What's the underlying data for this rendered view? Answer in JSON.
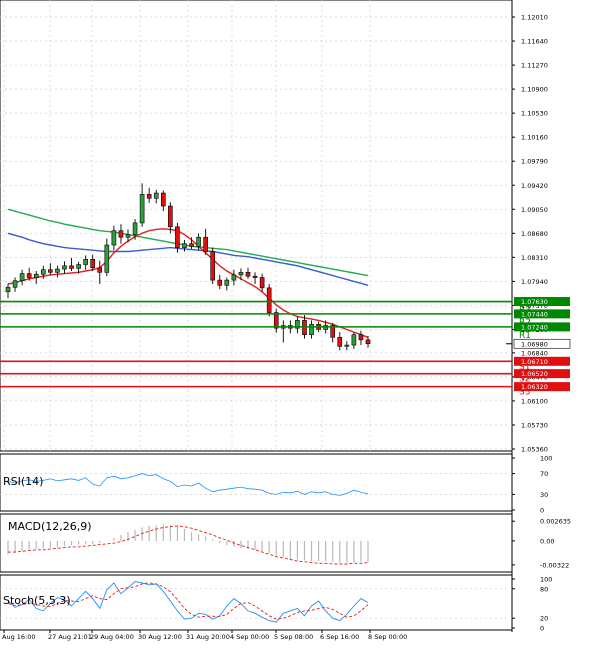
{
  "chart_data": [
    {
      "type": "candlestick",
      "panel": "price",
      "ylim": [
        1.0536,
        1.1201
      ],
      "y_ticks": [
        "1.12010",
        "1.11640",
        "1.11270",
        "1.10900",
        "1.10530",
        "1.10160",
        "1.09790",
        "1.09420",
        "1.09050",
        "1.08680",
        "1.08310",
        "1.07940",
        "1.07570",
        "1.07200",
        "1.06840",
        "1.06470",
        "1.06100",
        "1.05730",
        "1.05360"
      ],
      "x_ticks": [
        "Aug 16:00",
        "27 Aug 21:01",
        "29 Aug 04:00",
        "30 Aug 12:00",
        "31 Aug 20:00",
        "4 Sep 00:00",
        "5 Sep 08:00",
        "6 Sep 16:00",
        "8 Sep 00:00"
      ],
      "last_price": "1.06980",
      "candles": [
        [
          1.0778,
          1.079,
          1.0768,
          1.0785
        ],
        [
          1.0785,
          1.08,
          1.0778,
          1.0795
        ],
        [
          1.0795,
          1.0812,
          1.0788,
          1.0806
        ],
        [
          1.0806,
          1.0815,
          1.0795,
          1.08
        ],
        [
          1.08,
          1.081,
          1.079,
          1.0805
        ],
        [
          1.0805,
          1.0818,
          1.0798,
          1.0812
        ],
        [
          1.0812,
          1.0822,
          1.0804,
          1.0808
        ],
        [
          1.0808,
          1.0818,
          1.08,
          1.0813
        ],
        [
          1.0813,
          1.0825,
          1.0806,
          1.0818
        ],
        [
          1.0818,
          1.083,
          1.081,
          1.0814
        ],
        [
          1.0814,
          1.0824,
          1.0806,
          1.082
        ],
        [
          1.082,
          1.0834,
          1.0812,
          1.0828
        ],
        [
          1.0828,
          1.0835,
          1.081,
          1.0815
        ],
        [
          1.0815,
          1.0826,
          1.079,
          1.0808
        ],
        [
          1.0808,
          1.086,
          1.0802,
          1.085
        ],
        [
          1.085,
          1.088,
          1.0842,
          1.0872
        ],
        [
          1.0872,
          1.0882,
          1.0852,
          1.0862
        ],
        [
          1.0862,
          1.0874,
          1.0854,
          1.0866
        ],
        [
          1.0866,
          1.089,
          1.0858,
          1.0884
        ],
        [
          1.0884,
          1.0945,
          1.0878,
          1.0928
        ],
        [
          1.0928,
          1.0938,
          1.0915,
          1.0922
        ],
        [
          1.0922,
          1.0935,
          1.0914,
          1.093
        ],
        [
          1.093,
          1.0934,
          1.0902,
          1.091
        ],
        [
          1.091,
          1.0916,
          1.0868,
          1.0878
        ],
        [
          1.0878,
          1.0884,
          1.0838,
          1.0846
        ],
        [
          1.0846,
          1.0858,
          1.084,
          1.0852
        ],
        [
          1.0852,
          1.0862,
          1.0844,
          1.0848
        ],
        [
          1.0848,
          1.0868,
          1.0842,
          1.0862
        ],
        [
          1.0862,
          1.0875,
          1.0835,
          1.084
        ],
        [
          1.084,
          1.0846,
          1.079,
          1.0796
        ],
        [
          1.0796,
          1.0804,
          1.0782,
          1.0788
        ],
        [
          1.0788,
          1.08,
          1.078,
          1.0796
        ],
        [
          1.0796,
          1.0812,
          1.0788,
          1.0804
        ],
        [
          1.0804,
          1.0814,
          1.0796,
          1.0808
        ],
        [
          1.0808,
          1.0815,
          1.0798,
          1.0802
        ],
        [
          1.0802,
          1.0808,
          1.079,
          1.08
        ],
        [
          1.08,
          1.0806,
          1.0778,
          1.0784
        ],
        [
          1.0784,
          1.079,
          1.074,
          1.0746
        ],
        [
          1.0746,
          1.0752,
          1.0715,
          1.0722
        ],
        [
          1.0722,
          1.0734,
          1.07,
          1.0726
        ],
        [
          1.0726,
          1.0734,
          1.0714,
          1.0722
        ],
        [
          1.0722,
          1.074,
          1.0714,
          1.0734
        ],
        [
          1.0734,
          1.0742,
          1.0706,
          1.0712
        ],
        [
          1.0712,
          1.0734,
          1.0706,
          1.0728
        ],
        [
          1.0728,
          1.0732,
          1.0716,
          1.072
        ],
        [
          1.072,
          1.0734,
          1.0714,
          1.0726
        ],
        [
          1.0726,
          1.073,
          1.07,
          1.0708
        ],
        [
          1.0708,
          1.0716,
          1.0688,
          1.0694
        ],
        [
          1.0694,
          1.0702,
          1.0688,
          1.0696
        ],
        [
          1.0696,
          1.0716,
          1.069,
          1.0712
        ],
        [
          1.0712,
          1.0718,
          1.0696,
          1.0704
        ],
        [
          1.0704,
          1.071,
          1.0692,
          1.0698
        ]
      ],
      "series": [
        {
          "color": "#22aa55",
          "values": [
            1.0905,
            1.0902,
            1.0899,
            1.0896,
            1.0893,
            1.089,
            1.0887,
            1.0885,
            1.0882,
            1.088,
            1.0878,
            1.0876,
            1.0874,
            1.0872,
            1.0871,
            1.087,
            1.0868,
            1.0866,
            1.0864,
            1.0862,
            1.086,
            1.0858,
            1.0856,
            1.0854,
            1.0852,
            1.085,
            1.0848,
            1.0847,
            1.0846,
            1.0845,
            1.0844,
            1.0843,
            1.0841,
            1.0839,
            1.0837,
            1.0835,
            1.0833,
            1.0831,
            1.0829,
            1.0827,
            1.0825,
            1.0823,
            1.0821,
            1.0819,
            1.0817,
            1.0815,
            1.0813,
            1.0811,
            1.0809,
            1.0807,
            1.0805,
            1.0803
          ]
        },
        {
          "color": "#3a5bd0",
          "values": [
            1.0868,
            1.0865,
            1.0862,
            1.0858,
            1.0855,
            1.0852,
            1.085,
            1.0848,
            1.0846,
            1.0845,
            1.0844,
            1.0843,
            1.0842,
            1.0841,
            1.084,
            1.084,
            1.084,
            1.084,
            1.0841,
            1.0842,
            1.0843,
            1.0844,
            1.0845,
            1.0846,
            1.0845,
            1.0844,
            1.0843,
            1.0842,
            1.0841,
            1.084,
            1.0838,
            1.0836,
            1.0834,
            1.0833,
            1.0832,
            1.083,
            1.0828,
            1.0826,
            1.0824,
            1.0822,
            1.082,
            1.0818,
            1.0815,
            1.0812,
            1.0809,
            1.0806,
            1.0803,
            1.08,
            1.0797,
            1.0794,
            1.0791,
            1.0788
          ]
        },
        {
          "color": "#e02020",
          "values": [
            1.079,
            1.0792,
            1.0795,
            1.0798,
            1.08,
            1.0802,
            1.0804,
            1.0805,
            1.0806,
            1.0807,
            1.0808,
            1.081,
            1.0812,
            1.0815,
            1.0825,
            1.0838,
            1.0848,
            1.0856,
            1.0863,
            1.0868,
            1.0872,
            1.0874,
            1.0875,
            1.0874,
            1.0872,
            1.0866,
            1.0858,
            1.0848,
            1.0838,
            1.0828,
            1.0818,
            1.081,
            1.0804,
            1.0798,
            1.0792,
            1.0786,
            1.0778,
            1.0768,
            1.0758,
            1.075,
            1.0744,
            1.074,
            1.0738,
            1.0736,
            1.0734,
            1.0731,
            1.0728,
            1.0724,
            1.072,
            1.0716,
            1.0712,
            1.0708
          ]
        }
      ],
      "levels": [
        {
          "label": "R3",
          "value": 1.0763,
          "value_text": "1.07630",
          "color": "#008800"
        },
        {
          "label": "R2",
          "value": 1.0744,
          "value_text": "1.07440",
          "color": "#008800"
        },
        {
          "label": "R1",
          "value": 1.0724,
          "value_text": "1.07240",
          "color": "#008800"
        },
        {
          "label": "S1",
          "value": 1.0671,
          "value_text": "1.06710",
          "color": "#e01010"
        },
        {
          "label": "S2",
          "value": 1.0652,
          "value_text": "1.06520",
          "color": "#e01010"
        },
        {
          "label": "S3",
          "value": 1.0632,
          "value_text": "1.06320",
          "color": "#e01010"
        }
      ]
    },
    {
      "type": "line",
      "panel": "rsi",
      "title": "RSI(14)",
      "ylim": [
        0,
        100
      ],
      "y_ticks": [
        "100",
        "70",
        "30",
        "0"
      ],
      "series": [
        {
          "color": "#1e90ff",
          "values": [
            55,
            52,
            56,
            58,
            55,
            57,
            60,
            56,
            58,
            60,
            57,
            62,
            50,
            46,
            62,
            65,
            60,
            62,
            66,
            70,
            66,
            68,
            60,
            55,
            45,
            48,
            46,
            52,
            42,
            35,
            38,
            40,
            42,
            44,
            41,
            40,
            38,
            32,
            30,
            34,
            33,
            36,
            30,
            35,
            33,
            35,
            30,
            28,
            32,
            38,
            34,
            31
          ]
        }
      ]
    },
    {
      "type": "line",
      "panel": "macd",
      "title": "MACD(12,26,9)",
      "ylim": [
        -0.0035,
        0.0028
      ],
      "y_ticks": [
        "0.002635",
        "0.00",
        "-0.00322"
      ],
      "histogram": [
        -0.0018,
        -0.0016,
        -0.0014,
        -0.0012,
        -0.0011,
        -0.001,
        -0.0009,
        -0.0008,
        -0.0007,
        -0.0006,
        -0.0005,
        -0.0004,
        -0.0004,
        -0.0003,
        0.0,
        0.0004,
        0.0008,
        0.0012,
        0.0015,
        0.0018,
        0.002,
        0.0021,
        0.0022,
        0.0021,
        0.0019,
        0.0016,
        0.0012,
        0.0009,
        0.0006,
        0.0002,
        -0.0003,
        -0.0006,
        -0.0008,
        -0.001,
        -0.0011,
        -0.0012,
        -0.0014,
        -0.0017,
        -0.002,
        -0.0022,
        -0.0024,
        -0.0025,
        -0.0026,
        -0.0027,
        -0.0027,
        -0.0027,
        -0.0028,
        -0.0029,
        -0.0029,
        -0.0029,
        -0.0028,
        -0.0028
      ],
      "signal": [
        -0.0015,
        -0.0015,
        -0.0014,
        -0.0013,
        -0.0012,
        -0.0012,
        -0.0011,
        -0.001,
        -0.0009,
        -0.0008,
        -0.0008,
        -0.0007,
        -0.0006,
        -0.0005,
        -0.0004,
        -0.0003,
        -0.0001,
        0.0002,
        0.0006,
        0.001,
        0.0013,
        0.0016,
        0.0018,
        0.0019,
        0.002,
        0.0019,
        0.0017,
        0.0014,
        0.0011,
        0.0008,
        0.0004,
        0.0001,
        -0.0003,
        -0.0006,
        -0.0009,
        -0.0012,
        -0.0015,
        -0.0018,
        -0.0021,
        -0.0023,
        -0.0025,
        -0.0027,
        -0.0028,
        -0.0029,
        -0.003,
        -0.003,
        -0.0031,
        -0.0031,
        -0.0031,
        -0.003,
        -0.003,
        -0.0029
      ]
    },
    {
      "type": "line",
      "panel": "stoch",
      "title": "Stoch(5,5,3)",
      "ylim": [
        0,
        100
      ],
      "y_ticks": [
        "100",
        "80",
        "20",
        "0"
      ],
      "series": [
        {
          "color": "#1e90ff",
          "values": [
            55,
            42,
            48,
            58,
            40,
            35,
            50,
            62,
            58,
            45,
            60,
            75,
            60,
            40,
            78,
            92,
            70,
            82,
            95,
            92,
            88,
            90,
            75,
            55,
            35,
            18,
            20,
            30,
            28,
            18,
            25,
            45,
            60,
            50,
            35,
            30,
            22,
            15,
            12,
            30,
            35,
            40,
            25,
            45,
            55,
            35,
            20,
            15,
            28,
            45,
            60,
            52
          ]
        },
        {
          "color": "#e02020",
          "values": [
            50,
            46,
            48,
            50,
            48,
            45,
            44,
            50,
            56,
            55,
            54,
            60,
            66,
            60,
            58,
            70,
            80,
            82,
            84,
            90,
            92,
            90,
            84,
            74,
            58,
            40,
            28,
            22,
            24,
            24,
            23,
            28,
            40,
            50,
            52,
            45,
            35,
            25,
            18,
            20,
            25,
            32,
            35,
            36,
            40,
            42,
            38,
            30,
            22,
            25,
            35,
            48
          ]
        }
      ]
    }
  ]
}
